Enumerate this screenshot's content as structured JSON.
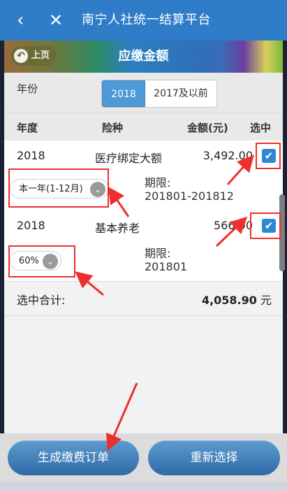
{
  "topbar": {
    "back_icon": "‹",
    "close_icon": "✕",
    "title": "南宁人社统一结算平台"
  },
  "banner": {
    "back_label": "上页",
    "title": "应缴金额"
  },
  "year_filter": {
    "label": "年份",
    "options": [
      "2018",
      "2017及以前"
    ],
    "selected": "2018"
  },
  "table": {
    "headers": [
      "年度",
      "险种",
      "金额(元)",
      "选中"
    ],
    "rows": [
      {
        "year": "2018",
        "type": "医疗绑定大额",
        "amount": "3,492.00",
        "checked": true,
        "selector": "本一年(1-12月)",
        "period_label": "期限:",
        "period_value": "201801-201812"
      },
      {
        "year": "2018",
        "type": "基本养老",
        "amount": "566.90",
        "checked": true,
        "selector": "60%",
        "period_label": "期限:",
        "period_value": "201801"
      }
    ]
  },
  "summary": {
    "label": "选中合计:",
    "value": "4,058.90",
    "unit": "元"
  },
  "actions": {
    "generate": "生成缴费订单",
    "reset": "重新选择"
  },
  "colors": {
    "topbar": "#2f7cc8",
    "accent": "#4d9ad6",
    "checkbox": "#2f86d4",
    "annotation": "#ee2f2f"
  }
}
